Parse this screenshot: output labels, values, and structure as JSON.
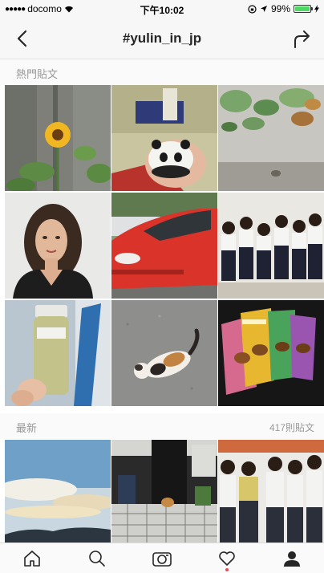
{
  "status_bar": {
    "carrier": "docomo",
    "time": "下午10:02",
    "battery_percent": "99%",
    "battery_level": 0.99
  },
  "nav": {
    "title": "#yulin_in_jp",
    "back_icon": "chevron-left-icon",
    "share_icon": "share-arrow-icon"
  },
  "top_posts": {
    "label": "熱門貼文",
    "photos": [
      "sunflower-photo",
      "panda-plush-photo",
      "leaves-photo",
      "woman-portrait-photo",
      "red-car-photo",
      "students-photo",
      "drink-bottle-photo",
      "cat-photo",
      "tea-packages-photo"
    ]
  },
  "recent": {
    "label": "最新",
    "count": "417則貼文",
    "photos": [
      "sky-photo",
      "street-photo",
      "group-photo"
    ]
  },
  "tab_bar": {
    "items": [
      "home-icon",
      "search-icon",
      "camera-icon",
      "heart-icon",
      "profile-icon"
    ],
    "active": "profile-icon"
  },
  "colors": {
    "accent_notification": "#ed4956",
    "battery": "#4cd964",
    "bar_background": "#f7f7f7"
  }
}
